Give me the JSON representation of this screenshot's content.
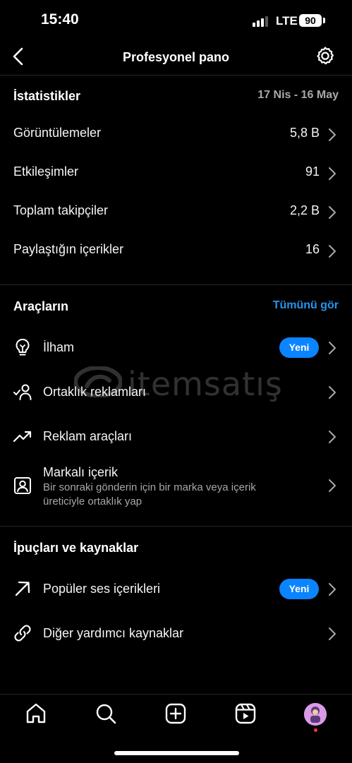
{
  "status": {
    "time": "15:40",
    "network": "LTE",
    "battery": "90"
  },
  "header": {
    "title": "Profesyonel pano"
  },
  "stats": {
    "title": "İstatistikler",
    "date_range": "17 Nis - 16 May",
    "rows": [
      {
        "label": "Görüntülemeler",
        "value": "5,8 B"
      },
      {
        "label": "Etkileşimler",
        "value": "91"
      },
      {
        "label": "Toplam takipçiler",
        "value": "2,2 B"
      },
      {
        "label": "Paylaştığın içerikler",
        "value": "16"
      }
    ]
  },
  "tools": {
    "title": "Araçların",
    "see_all": "Tümünü gör",
    "items": [
      {
        "label": "İlham",
        "badge": "Yeni",
        "icon": "lightbulb-icon"
      },
      {
        "label": "Ortaklık reklamları",
        "icon": "partnership-icon"
      },
      {
        "label": "Reklam araçları",
        "icon": "trending-up-icon"
      },
      {
        "label": "Markalı içerik",
        "description": "Bir sonraki gönderin için bir marka veya içerik üreticiyle ortaklık yap",
        "icon": "branded-content-icon"
      }
    ]
  },
  "tips": {
    "title": "İpuçları ve kaynaklar",
    "items": [
      {
        "label": "Popüler ses içerikleri",
        "badge": "Yeni",
        "icon": "arrow-up-right-icon"
      },
      {
        "label": "Diğer yardımcı kaynaklar",
        "icon": "link-icon"
      }
    ]
  },
  "watermark": {
    "text": "itemsatış"
  },
  "tabbar": {
    "items": [
      "home-icon",
      "search-icon",
      "create-icon",
      "reels-icon",
      "profile-avatar"
    ]
  },
  "colors": {
    "accent": "#0a84ff",
    "link": "#2196f3",
    "background": "#000000",
    "secondary_text": "#a8a8a8"
  }
}
